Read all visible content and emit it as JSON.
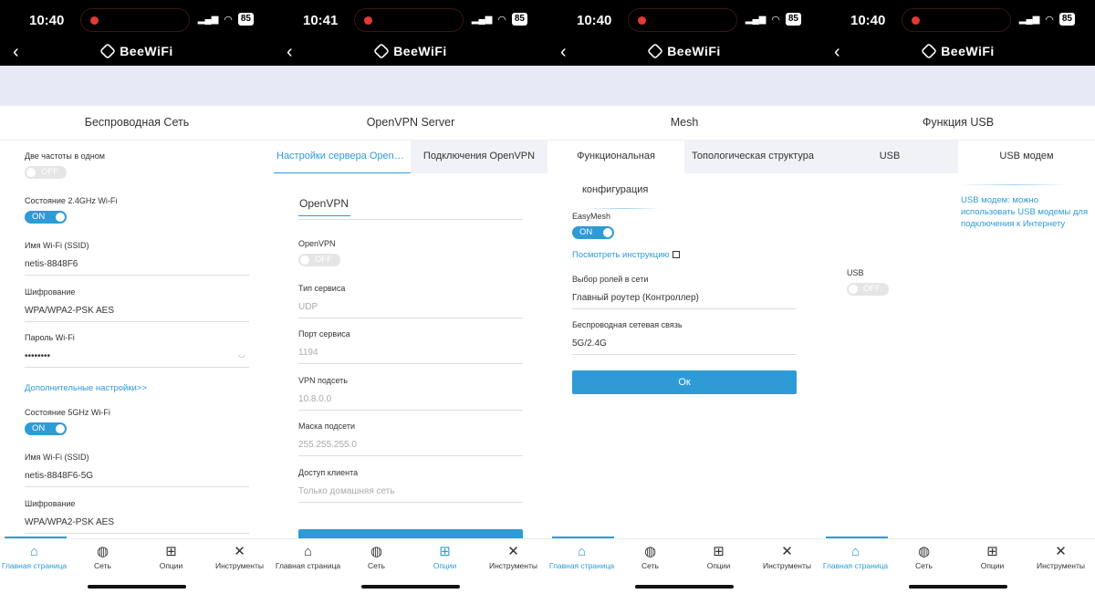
{
  "panels": [
    {
      "time": "10:40",
      "battery": "85",
      "brand": "BeeWiFi",
      "title": "Беспроводная Сеть",
      "fields": [
        {
          "label": "Две частоты в одном",
          "toggle": "OFF"
        },
        {
          "label": "Состояние 2.4GHz Wi-Fi",
          "toggle": "ON"
        },
        {
          "label": "Имя Wi-Fi (SSID)",
          "value": "netis-8848F6"
        },
        {
          "label": "Шифрование",
          "value": "WPA/WPA2-PSK AES"
        },
        {
          "label": "Пароль Wi-Fi",
          "value": "••••••••"
        },
        {
          "label": "Состояние 5GHz Wi-Fi",
          "toggle": "ON"
        },
        {
          "label": "Имя Wi-Fi (SSID)",
          "value": "netis-8848F6-5G"
        },
        {
          "label": "Шифрование",
          "value": "WPA/WPA2-PSK AES"
        }
      ],
      "advanced_link": "Дополнительные настройки>>",
      "active_tab": 0
    },
    {
      "time": "10:41",
      "battery": "85",
      "brand": "BeeWiFi",
      "title": "OpenVPN Server",
      "subtabs": [
        "Настройки сервера OpenV...",
        "Подключения OpenVPN"
      ],
      "section": "OpenVPN",
      "fields": [
        {
          "label": "OpenVPN",
          "toggle": "OFF"
        },
        {
          "label": "Тип сервиса",
          "value": "UDP"
        },
        {
          "label": "Порт сервиса",
          "value": "1194"
        },
        {
          "label": "VPN подсеть",
          "value": "10.8.0.0"
        },
        {
          "label": "Маска подсети",
          "value": "255.255.255.0"
        },
        {
          "label": "Доступ клиента",
          "value": "Только домашняя сеть"
        }
      ],
      "active_tab": 2
    },
    {
      "time": "10:40",
      "battery": "85",
      "brand": "BeeWiFi",
      "title": "Mesh",
      "subtabs": [
        "Функциональная",
        "Топологическая структура"
      ],
      "subtab_wrap": "конфигурация",
      "fields": [
        {
          "label": "EasyMesh",
          "toggle": "ON"
        },
        {
          "label": "Выбор ролей в сети",
          "value": "Главный роутер (Контроллер)"
        },
        {
          "label": "Беспроводная сетевая связь",
          "value": "5G/2.4G"
        }
      ],
      "instruction_link": "Посмотреть инструкцию",
      "ok": "Ок",
      "active_tab": 0
    },
    {
      "time": "10:40",
      "battery": "85",
      "brand": "BeeWiFi",
      "title": "Функция USB",
      "subtabs": [
        "USB",
        "USB модем"
      ],
      "hint": "USB модем: можно использовать USB модемы для подключения к Интернету",
      "fields": [
        {
          "label": "USB",
          "toggle": "OFF"
        }
      ],
      "active_tab": 0
    }
  ],
  "tabbar": [
    "Главная страница",
    "Сеть",
    "Опции",
    "Инструменты"
  ],
  "colors": {
    "accent": "#2e9bd6",
    "band": "#e7e9f7",
    "off": "#e5e5e5"
  }
}
